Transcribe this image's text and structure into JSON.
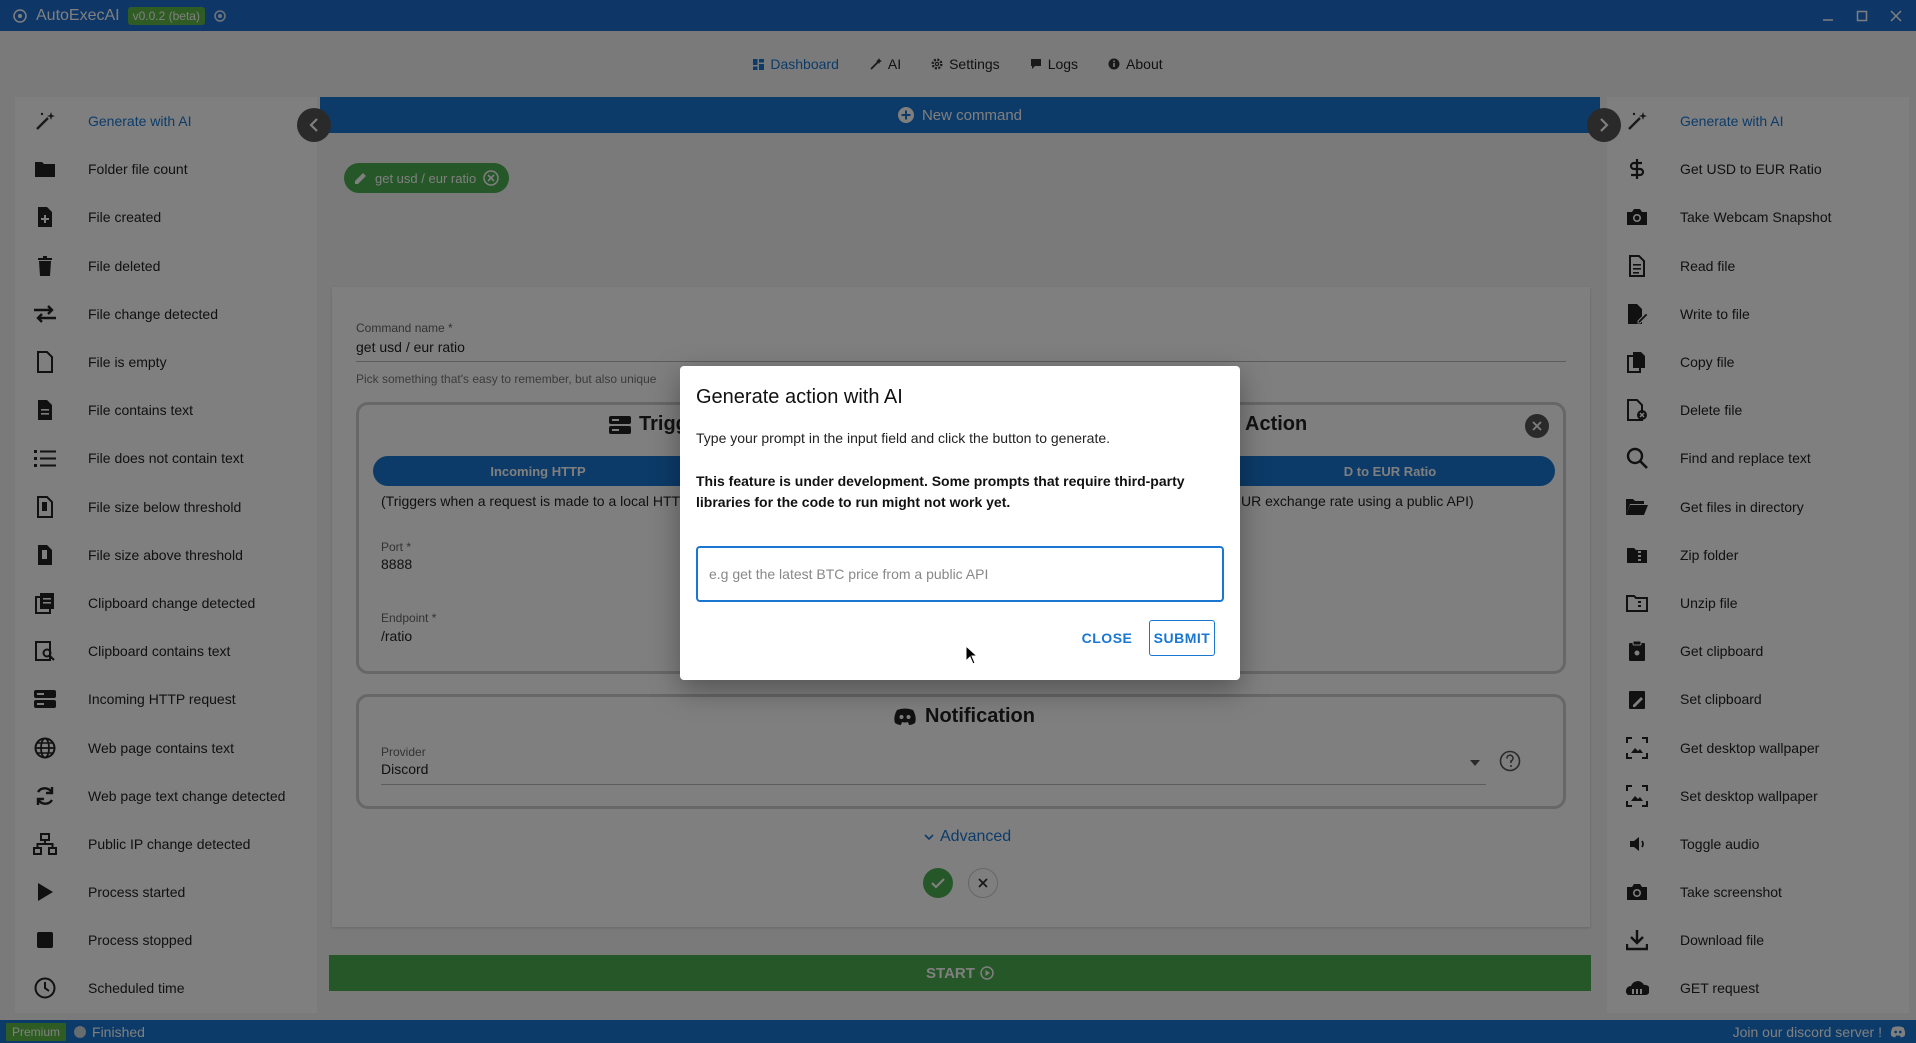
{
  "app": {
    "name": "AutoExecAI",
    "version": "v0.0.2 (beta)"
  },
  "nav": {
    "items": [
      {
        "label": "Dashboard",
        "icon": "grid-icon"
      },
      {
        "label": "AI",
        "icon": "magic-wand-icon"
      },
      {
        "label": "Settings",
        "icon": "gear-icon"
      },
      {
        "label": "Logs",
        "icon": "message-icon"
      },
      {
        "label": "About",
        "icon": "info-icon"
      }
    ]
  },
  "triggers": [
    {
      "label": "Generate with AI",
      "icon": "magic-wand-icon"
    },
    {
      "label": "Folder file count",
      "icon": "folder-icon"
    },
    {
      "label": "File created",
      "icon": "file-plus-icon"
    },
    {
      "label": "File deleted",
      "icon": "trash-icon"
    },
    {
      "label": "File change detected",
      "icon": "arrows-exchange-icon"
    },
    {
      "label": "File is empty",
      "icon": "file-outline-icon"
    },
    {
      "label": "File contains text",
      "icon": "file-text-icon"
    },
    {
      "label": "File does not contain text",
      "icon": "list-icon"
    },
    {
      "label": "File size below threshold",
      "icon": "file-size-icon"
    },
    {
      "label": "File size above threshold",
      "icon": "file-size-icon"
    },
    {
      "label": "Clipboard change detected",
      "icon": "clipboard-icon"
    },
    {
      "label": "Clipboard contains text",
      "icon": "clipboard-search-icon"
    },
    {
      "label": "Incoming HTTP request",
      "icon": "server-icon"
    },
    {
      "label": "Web page contains text",
      "icon": "globe-icon"
    },
    {
      "label": "Web page text change detected",
      "icon": "refresh-icon"
    },
    {
      "label": "Public IP change detected",
      "icon": "network-icon"
    },
    {
      "label": "Process started",
      "icon": "play-icon"
    },
    {
      "label": "Process stopped",
      "icon": "stop-icon"
    },
    {
      "label": "Scheduled time",
      "icon": "clock-icon"
    }
  ],
  "actions": [
    {
      "label": "Generate with AI",
      "icon": "magic-wand-icon"
    },
    {
      "label": "Get USD to EUR Ratio",
      "icon": "dollar-icon"
    },
    {
      "label": "Take Webcam Snapshot",
      "icon": "camera-icon"
    },
    {
      "label": "Read file",
      "icon": "file-text-icon"
    },
    {
      "label": "Write to file",
      "icon": "file-edit-icon"
    },
    {
      "label": "Copy file",
      "icon": "copy-icon"
    },
    {
      "label": "Delete file",
      "icon": "file-delete-icon"
    },
    {
      "label": "Find and replace text",
      "icon": "search-icon"
    },
    {
      "label": "Get files in directory",
      "icon": "folder-open-icon"
    },
    {
      "label": "Zip folder",
      "icon": "folder-zip-icon"
    },
    {
      "label": "Unzip file",
      "icon": "folder-outline-icon"
    },
    {
      "label": "Get clipboard",
      "icon": "clipboard-icon"
    },
    {
      "label": "Set clipboard",
      "icon": "clipboard-edit-icon"
    },
    {
      "label": "Get desktop wallpaper",
      "icon": "image-icon"
    },
    {
      "label": "Set desktop wallpaper",
      "icon": "image-icon"
    },
    {
      "label": "Toggle audio",
      "icon": "speaker-icon"
    },
    {
      "label": "Take screenshot",
      "icon": "camera-icon"
    },
    {
      "label": "Download file",
      "icon": "download-icon"
    },
    {
      "label": "GET request",
      "icon": "cloud-icon"
    }
  ],
  "main": {
    "new_command": "New command",
    "chip_label": "get usd / eur ratio",
    "command_name_label": "Command name *",
    "command_name_value": "get usd / eur ratio",
    "command_name_helper": "Pick something that's easy to remember, but also unique",
    "trigger_title": "Trigg",
    "trigger_pill": "Incoming HTTP",
    "trigger_desc": "(Triggers when a request is made to a local HTT",
    "port_label": "Port *",
    "port_value": "8888",
    "endpoint_label": "Endpoint *",
    "endpoint_value": "/ratio",
    "action_title": "Action",
    "action_pill": "D to EUR Ratio",
    "action_desc": "UR exchange rate using a public API)",
    "notification_title": "Notification",
    "provider_label": "Provider",
    "provider_value": "Discord",
    "advanced_label": "Advanced",
    "start_label": "START"
  },
  "status": {
    "premium": "Premium",
    "state": "Finished",
    "discord_link": "Join our discord server !"
  },
  "dialog": {
    "title": "Generate action with AI",
    "instructions": "Type your prompt in the input field and click the button to generate.",
    "warning": "This feature is under development. Some prompts that require third-party libraries for the code to run might not work yet.",
    "input_placeholder": "e.g get the latest BTC price from a public API",
    "input_value": "",
    "close_label": "CLOSE",
    "submit_label": "SUBMIT"
  },
  "colors": {
    "primary": "#1976d2",
    "titlebar": "#1d6fd0",
    "success": "#4caf50",
    "badge": "#5fb847"
  }
}
